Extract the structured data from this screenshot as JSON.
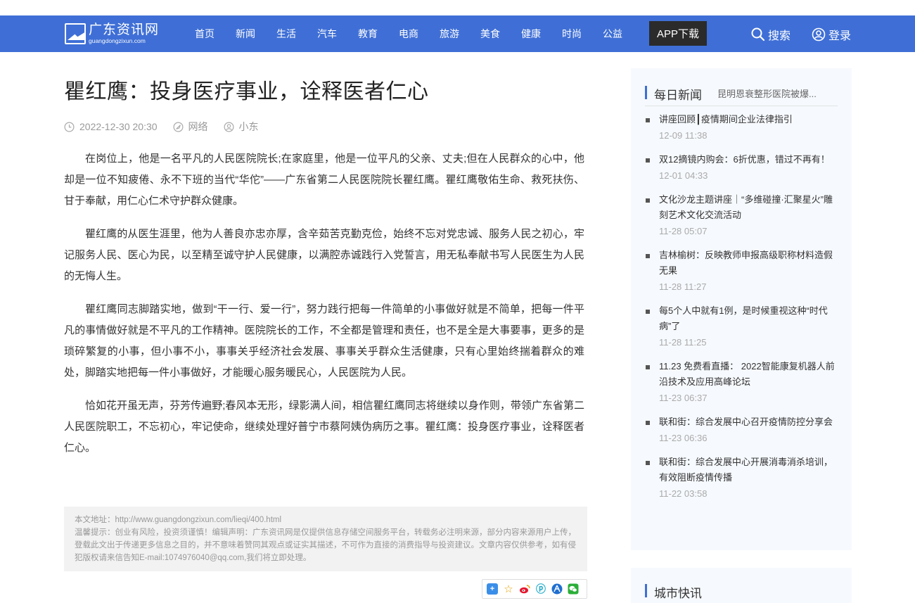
{
  "header": {
    "logo_cn": "广东资讯网",
    "logo_en": "guangdongzixun.com",
    "nav": [
      "首页",
      "新闻",
      "生活",
      "汽车",
      "教育",
      "电商",
      "旅游",
      "美食",
      "健康",
      "时尚",
      "公益"
    ],
    "app_button": "APP下载",
    "search_label": "搜索",
    "login_label": "登录",
    "bar_color": "#3f6fd6"
  },
  "article": {
    "title": "瞿红鹰：投身医疗事业，诠释医者仁心",
    "date": "2022-12-30 20:30",
    "source": "网络",
    "author": "小东",
    "paragraphs": [
      "在岗位上，他是一名平凡的人民医院院长;在家庭里，他是一位平凡的父亲、丈夫;但在人民群众的心中，他却是一位不知疲倦、永不下班的当代“华佗”——广东省第二人民医院院长瞿红鹰。瞿红鹰敬佑生命、救死扶伤、甘于奉献，用仁心仁术守护群众健康。",
      "瞿红鹰的从医生涯里，他为人善良亦忠亦厚，含辛茹苦克勤克俭，始终不忘对党忠诚、服务人民之初心，牢记服务人民、医心为民，以至精至诚守护人民健康，以满腔赤诚践行入党誓言，用无私奉献书写人民医生为人民的无悔人生。",
      "瞿红鹰同志脚踏实地，做到“干一行、爱一行”，努力践行把每一件简单的小事做好就是不简单，把每一件平凡的事情做好就是不平凡的工作精神。医院院长的工作，不全都是管理和责任，也不是全是大事要事，更多的是琐碎繁复的小事，但小事不小，事事关乎经济社会发展、事事关乎群众生活健康，只有心里始终揣着群众的难处，脚踏实地把每一件小事做好，才能暖心服务暖民心，人民医院为人民。",
      "恰如花开虽无声，芬芳传遍野;春风本无形，绿影满人间，相信瞿红鹰同志将继续以身作则，带领广东省第二人民医院职工，不忘初心，牢记使命，继续处理好普宁市蔡阿姨伪病历之事。瞿红鹰：投身医疗事业，诠释医者仁心。"
    ],
    "notice_lines": [
      "本文地址：http://www.guangdongzixun.com/lieqi/400.html",
      "温馨提示：创业有风险，投资须谨慎！编辑声明：广东资讯网是仅提供信息存储空间服务平台，转载务必注明来源，部分内容来源用户上传，登载此文出于传递更多信息之目的，并不意味着赞同其观点或证实其描述，不可作为直接的消费指导与投资建议。文章内容仅供参考，如有侵犯版权请来信告知E-mail:1074976040@qq.com,我们将立即处理。"
    ]
  },
  "sidebar": {
    "title": "每日新闻",
    "marquee": "昆明恩衰整形医院被爆...",
    "news": [
      {
        "text": "讲座回顾┃疫情期间企业法律指引",
        "time": "12-09 11:38"
      },
      {
        "text": "双12摘镜内购会：6折优惠，错过不再有！",
        "time": "12-01 04:33"
      },
      {
        "text": "文化沙龙主题讲座｜“多维碰撞·汇聚星火”雕刻艺术文化交流活动",
        "time": "11-28 05:07"
      },
      {
        "text": "吉林榆树：反映教师申报高级职称材料造假无果",
        "time": "11-28 11:27"
      },
      {
        "text": "每5个人中就有1例，是时候重视这种“时代病”了",
        "time": "11-28 11:25"
      },
      {
        "text": "11.23 免费看直播： 2022智能康复机器人前沿技术及应用高峰论坛",
        "time": "11-23 06:37"
      },
      {
        "text": "联和街：综合发展中心召开疫情防控分享会",
        "time": "11-23 06:36"
      },
      {
        "text": "联和街：综合发展中心开展消毒消杀培训，有效阻断疫情传播",
        "time": "11-22 03:58"
      }
    ],
    "title2": "城市快讯"
  },
  "share_icons": [
    "plus-icon",
    "star-icon",
    "weibo-icon",
    "pinterest-icon",
    "renren-icon",
    "wechat-icon"
  ]
}
